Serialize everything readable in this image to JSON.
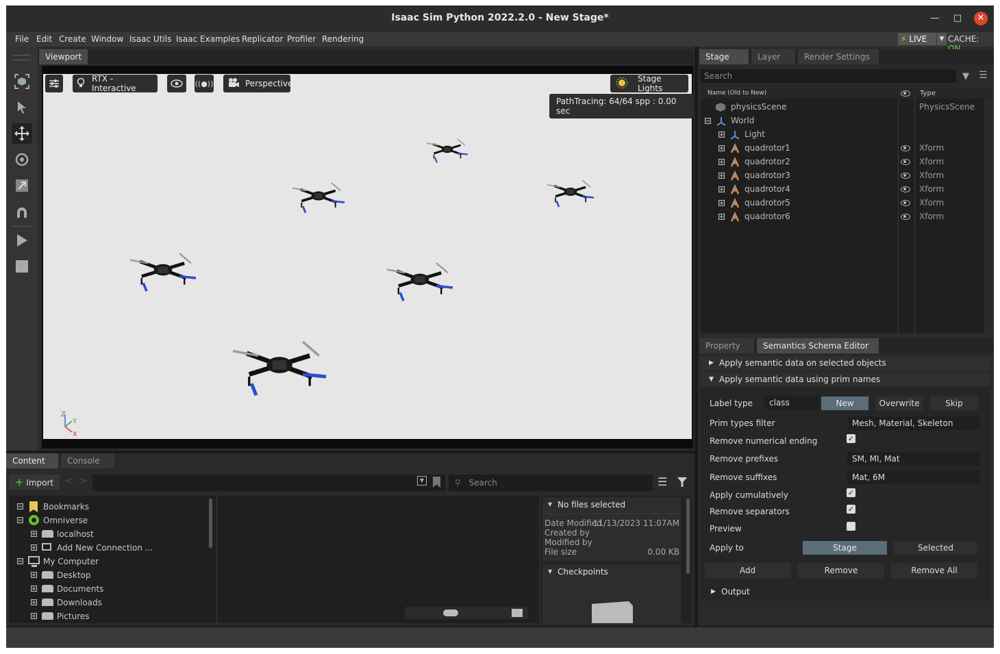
{
  "window": {
    "title": "Isaac Sim Python 2022.2.0 - New Stage*"
  },
  "menu": [
    "File",
    "Edit",
    "Create",
    "Window",
    "Isaac Utils",
    "Isaac Examples",
    "Replicator",
    "Profiler",
    "Rendering"
  ],
  "status": {
    "live_label": "LIVE",
    "cache_label": "CACHE:",
    "cache_value": "ON"
  },
  "viewport": {
    "tab": "Viewport",
    "renderer": "RTX - Interactive",
    "camera": "Perspective",
    "lights": "Stage Lights",
    "pathtracing": "PathTracing: 64/64 spp : 0.00 sec",
    "axis_labels": {
      "z": "Z",
      "y": "Y",
      "x": "X"
    }
  },
  "stage": {
    "tabs": [
      "Stage",
      "Layer",
      "Render Settings"
    ],
    "search_placeholder": "Search",
    "col_name": "Name (Old to New)",
    "col_type": "Type",
    "items": [
      {
        "name": "physicsScene",
        "type": "PhysicsScene"
      },
      {
        "name": "World",
        "type": ""
      },
      {
        "name": "Light",
        "type": ""
      },
      {
        "name": "quadrotor1",
        "type": "Xform"
      },
      {
        "name": "quadrotor2",
        "type": "Xform"
      },
      {
        "name": "quadrotor3",
        "type": "Xform"
      },
      {
        "name": "quadrotor4",
        "type": "Xform"
      },
      {
        "name": "quadrotor5",
        "type": "Xform"
      },
      {
        "name": "quadrotor6",
        "type": "Xform"
      }
    ]
  },
  "semantics": {
    "tabs": [
      "Property",
      "Semantics Schema Editor"
    ],
    "section1": "Apply semantic data on selected objects",
    "section2": "Apply semantic data using prim names",
    "label_type": {
      "label": "Label type",
      "value": "class",
      "buttons": [
        "New",
        "Overwrite",
        "Skip"
      ]
    },
    "prim_types_filter": {
      "label": "Prim types filter",
      "value": "Mesh, Material, Skeleton"
    },
    "remove_numerical_ending": "Remove numerical ending",
    "remove_prefixes": {
      "label": "Remove prefixes",
      "value": "SM, MI, Mat"
    },
    "remove_suffixes": {
      "label": "Remove suffixes",
      "value": "Mat, 6M"
    },
    "apply_cumulatively": "Apply cumulatively",
    "remove_separators": "Remove separators",
    "preview": "Preview",
    "apply_to": {
      "label": "Apply to",
      "options": [
        "Stage",
        "Selected"
      ]
    },
    "actions": [
      "Add",
      "Remove",
      "Remove All"
    ],
    "output": "Output"
  },
  "content": {
    "tabs": [
      "Content",
      "Console"
    ],
    "import_label": "Import",
    "search_placeholder": "Search",
    "tree": [
      {
        "label": "Bookmarks"
      },
      {
        "label": "Omniverse"
      },
      {
        "label": "localhost"
      },
      {
        "label": "Add New Connection ..."
      },
      {
        "label": "My Computer"
      },
      {
        "label": "Desktop"
      },
      {
        "label": "Documents"
      },
      {
        "label": "Downloads"
      },
      {
        "label": "Pictures"
      }
    ],
    "info": {
      "header": "No files selected",
      "date_modified_label": "Date Modified",
      "date_modified_value": "11/13/2023 11:07AM",
      "created_by_label": "Created by",
      "modified_by_label": "Modified by",
      "file_size_label": "File size",
      "file_size_value": "0.00 KB",
      "checkpoints": "Checkpoints"
    }
  }
}
